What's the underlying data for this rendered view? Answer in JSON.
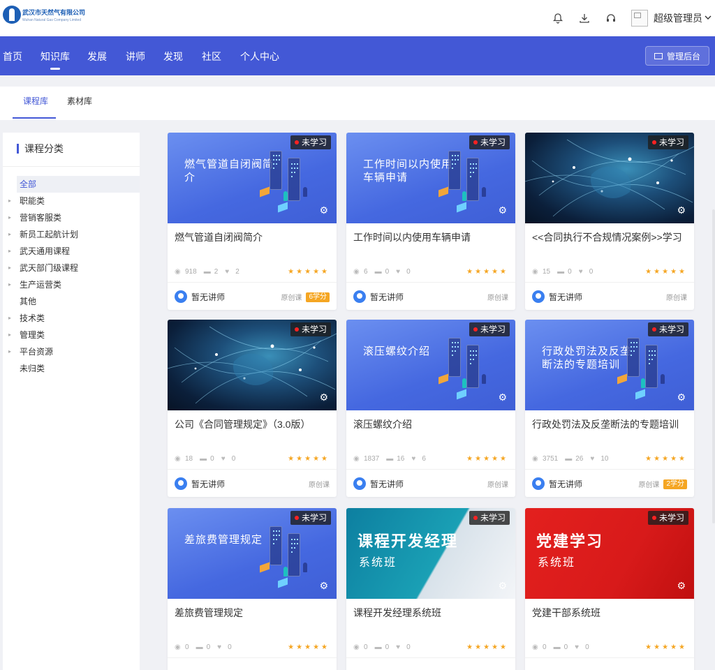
{
  "header": {
    "logo_cn": "武汉市天然气有限公司",
    "logo_en": "Wuhan Natural Gas Company Limited",
    "user_name": "超级管理员"
  },
  "nav": {
    "items": [
      "首页",
      "知识库",
      "发展",
      "讲师",
      "发现",
      "社区",
      "个人中心"
    ],
    "active_index": 1,
    "admin_label": "管理后台"
  },
  "subtabs": {
    "items": [
      "课程库",
      "素材库"
    ],
    "active_index": 0
  },
  "sidebar": {
    "title": "课程分类",
    "items": [
      {
        "label": "全部",
        "selected": true,
        "arrow": false
      },
      {
        "label": "职能类",
        "arrow": true
      },
      {
        "label": "营销客服类",
        "arrow": true
      },
      {
        "label": "新员工起航计划",
        "arrow": true
      },
      {
        "label": "武天通用课程",
        "arrow": true
      },
      {
        "label": "武天部门级课程",
        "arrow": true
      },
      {
        "label": "生产运营类",
        "arrow": true
      },
      {
        "label": "其他",
        "arrow": false
      },
      {
        "label": "技术类",
        "arrow": true
      },
      {
        "label": "管理类",
        "arrow": true
      },
      {
        "label": "平台资源",
        "arrow": true
      },
      {
        "label": "未归类",
        "arrow": false
      }
    ]
  },
  "courses": [
    {
      "thumb": "blue",
      "thumb_title": "燃气管道自闭阀简介",
      "title": "燃气管道自闭阀简介",
      "status": "未学习",
      "views": "918",
      "comments": "2",
      "likes": "2",
      "teacher": "暂无讲师",
      "type": "原创课",
      "credit": "6学分"
    },
    {
      "thumb": "blue",
      "thumb_title": "工作时间以内使用车辆申请",
      "title": "工作时间以内使用车辆申请",
      "status": "未学习",
      "views": "6",
      "comments": "0",
      "likes": "0",
      "teacher": "暂无讲师",
      "type": "原创课",
      "credit": ""
    },
    {
      "thumb": "globe",
      "thumb_title": "",
      "title": "<<合同执行不合规情况案例>>学习",
      "status": "未学习",
      "views": "15",
      "comments": "0",
      "likes": "0",
      "teacher": "暂无讲师",
      "type": "原创课",
      "credit": ""
    },
    {
      "thumb": "globe",
      "thumb_title": "",
      "title": "公司《合同管理规定》（3.0版）",
      "status": "未学习",
      "views": "18",
      "comments": "0",
      "likes": "0",
      "teacher": "暂无讲师",
      "type": "原创课",
      "credit": ""
    },
    {
      "thumb": "blue",
      "thumb_title": "滚压螺纹介绍",
      "title": "滚压螺纹介绍",
      "status": "未学习",
      "views": "1837",
      "comments": "16",
      "likes": "6",
      "teacher": "暂无讲师",
      "type": "原创课",
      "credit": ""
    },
    {
      "thumb": "blue",
      "thumb_title": "行政处罚法及反垄断法的专题培训",
      "title": "行政处罚法及反垄断法的专题培训",
      "status": "未学习",
      "views": "3751",
      "comments": "26",
      "likes": "10",
      "teacher": "暂无讲师",
      "type": "原创课",
      "credit": "2学分"
    },
    {
      "thumb": "blue",
      "thumb_title": "差旅费管理规定",
      "title": "差旅费管理规定",
      "status": "未学习",
      "views": "0",
      "comments": "0",
      "likes": "0",
      "teacher": "",
      "type": "",
      "credit": ""
    },
    {
      "thumb": "teal",
      "thumb_title": "",
      "thumb_big": "课程开发经理",
      "thumb_sub": "系统班",
      "title": "课程开发经理系统班",
      "status": "未学习",
      "views": "0",
      "comments": "0",
      "likes": "0",
      "teacher": "",
      "type": "",
      "credit": ""
    },
    {
      "thumb": "red",
      "thumb_title": "",
      "thumb_big": "党建学习",
      "thumb_sub": "系统班",
      "title": "党建干部系统班",
      "status": "未学习",
      "views": "0",
      "comments": "0",
      "likes": "0",
      "teacher": "",
      "type": "",
      "credit": ""
    }
  ],
  "colors": {
    "primary": "#4358d6",
    "star": "#f5a623",
    "credit": "#f5a623"
  }
}
